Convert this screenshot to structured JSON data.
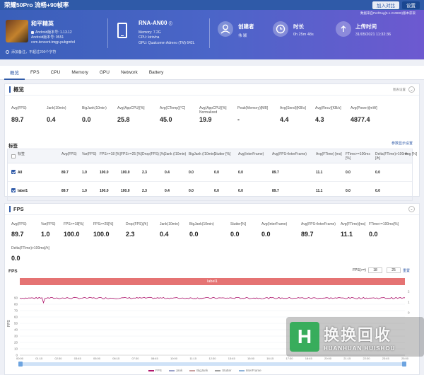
{
  "window": {
    "title": "荣耀50Pro 流畅+90帧率",
    "buttons": [
      "加入对比",
      "设置"
    ]
  },
  "app": {
    "name": "和平精英",
    "lines": [
      "Android版本号: 1.13.12",
      "Android版本号: 9551",
      "com.tencent.tmgp.pubgmhd"
    ]
  },
  "device": {
    "name": "RNA-AN00",
    "lines": [
      "Memory: 7.2G",
      "CPU: kirin/na",
      "GPU: Qualcomm Adreno (TM) 642L"
    ]
  },
  "creator": {
    "label": "创建者",
    "value": "伟 颖"
  },
  "duration": {
    "label": "时长",
    "value": "0h 25m 48s"
  },
  "upload": {
    "label": "上传时间",
    "value": "31/05/2021 11:32:36"
  },
  "perfdog_note": "数据来自PerfDog(5.1.210800)版本获取",
  "search_hint": "添加备注，不超过200个字符",
  "tabs": [
    "概览",
    "FPS",
    "CPU",
    "Memory",
    "GPU",
    "Network",
    "Battery"
  ],
  "overview": {
    "title": "概览",
    "hint": "图表设置",
    "metrics": [
      {
        "label": "Avg(FPS)",
        "value": "89.7"
      },
      {
        "label": "Jank(10min)",
        "value": "0.4"
      },
      {
        "label": "BigJank(10min)",
        "value": "0.0"
      },
      {
        "label": "Avg(AppCPU)[%]",
        "value": "25.8"
      },
      {
        "label": "Avg(CTemp)[°C]",
        "value": "45.0"
      },
      {
        "label": "Avg(AppCPU)[%] Normalized",
        "value": "19.9"
      },
      {
        "label": "Peak(Memory)[MB]",
        "value": "-"
      },
      {
        "label": "Avg(Send)[KB/s]",
        "value": "4.4"
      },
      {
        "label": "Avg(Recv)[KB/s]",
        "value": "4.3"
      },
      {
        "label": "Avg(Power)[mW]",
        "value": "4877.4"
      }
    ]
  },
  "labels_table": {
    "title": "标签",
    "link": "参数显示设置",
    "headers": [
      "标签",
      "Avg(FPS)",
      "Var(FPS)",
      "FPS>=18 [%]",
      "FPS>=25 [%]",
      "Drop(FPS) [/h]",
      "Jank (/10min)",
      "BigJank (/10min)",
      "Stutter [%]",
      "Avg(InterFrame)",
      "Avg(FPS+InterFrame)",
      "Avg(FTime) [ms]",
      "FTime>=100ms [%]",
      "Delta(FTime)>100ms [/h]",
      "Avg [%]"
    ],
    "rows": [
      {
        "label": "All",
        "cells": [
          "89.7",
          "1.0",
          "100.0",
          "100.0",
          "2.3",
          "0.4",
          "0.0",
          "0.0",
          "0.0",
          "89.7",
          "11.1",
          "0.0",
          "0.0"
        ]
      },
      {
        "label": "label1",
        "cells": [
          "89.7",
          "1.0",
          "100.0",
          "100.0",
          "2.3",
          "0.4",
          "0.0",
          "0.0",
          "0.0",
          "89.7",
          "11.1",
          "0.0",
          "0.0"
        ]
      }
    ]
  },
  "fps_panel": {
    "title": "FPS",
    "metrics": [
      {
        "label": "Avg(FPS)",
        "value": "89.7"
      },
      {
        "label": "Var(FPS)",
        "value": "1.0"
      },
      {
        "label": "FPS>=18[%]",
        "value": "100.0"
      },
      {
        "label": "FPS>=25[%]",
        "value": "100.0"
      },
      {
        "label": "Drop(FPS)[/h]",
        "value": "2.3"
      },
      {
        "label": "Jank(10min)",
        "value": "0.4"
      },
      {
        "label": "BigJank(10min)",
        "value": "0.0"
      },
      {
        "label": "Stutter[%]",
        "value": "0.0"
      },
      {
        "label": "Avg(InterFrame)",
        "value": "0.0"
      },
      {
        "label": "Avg(FPS+InterFrame)",
        "value": "89.7"
      },
      {
        "label": "Avg(FTime)[ms]",
        "value": "11.1"
      },
      {
        "label": "FTime>=100ms[%]",
        "value": "0.0"
      },
      {
        "label": "Delta(FTime)>100ms[/h]",
        "value": "0.0"
      }
    ]
  },
  "chart_section": {
    "title": "FPS",
    "range_label": "FPS(>=)",
    "range_values": [
      "18",
      "25"
    ],
    "reset_label": "重置",
    "label_bar": "label1"
  },
  "chart_data": {
    "type": "line",
    "ylabel": "FPS",
    "y_ticks": [
      "90",
      "80",
      "70",
      "60",
      "50",
      "40",
      "30",
      "20",
      "10",
      "0"
    ],
    "y2_ticks": [
      "2",
      "1",
      "0"
    ],
    "x_ticks": [
      "00:00",
      "01:15",
      "02:30",
      "03:45",
      "05:00",
      "06:15",
      "07:30",
      "08:45",
      "10:00",
      "11:15",
      "12:30",
      "13:45",
      "15:00",
      "16:15",
      "17:30",
      "18:45",
      "20:00",
      "21:15",
      "22:30",
      "23:45",
      "25:00"
    ],
    "ylim": [
      0,
      100
    ],
    "series": [
      {
        "name": "FPS",
        "color": "#b0176d",
        "mean": 89.7
      },
      {
        "name": "Jank",
        "color": "#9aa0c8"
      },
      {
        "name": "BigJank",
        "color": "#c9a0a0"
      },
      {
        "name": "Stutter",
        "color": "#a0a0a0"
      },
      {
        "name": "InterFrame",
        "color": "#8fb3d9"
      }
    ]
  },
  "watermark": {
    "cn": "换换回收",
    "en": "HUANHUAN HUISHOU",
    "mark": "H"
  }
}
